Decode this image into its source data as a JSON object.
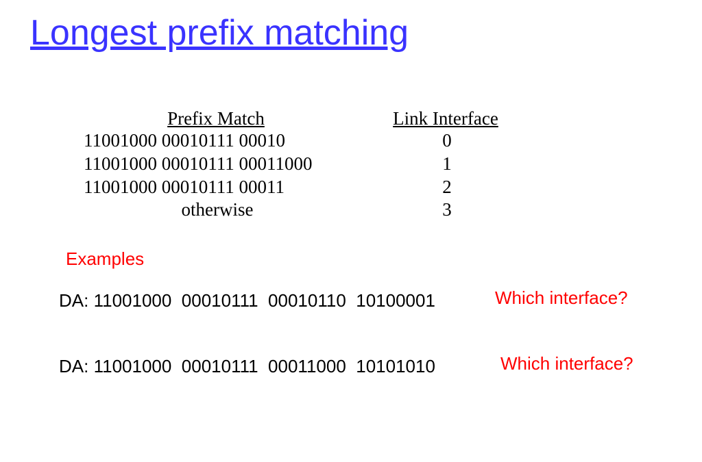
{
  "title": "Longest prefix matching",
  "table": {
    "headers": {
      "prefix": "Prefix Match",
      "link": "Link Interface"
    },
    "rows": [
      {
        "prefix": "11001000 00010111 00010",
        "link": "0"
      },
      {
        "prefix": "11001000 00010111 00011000",
        "link": "1"
      },
      {
        "prefix": "11001000 00010111 00011",
        "link": "2"
      },
      {
        "prefix": "otherwise",
        "link": "3",
        "otherwise": true
      }
    ]
  },
  "examples_label": "Examples",
  "examples": [
    {
      "prefix_label": "DA: ",
      "unhighlighted": "11001000  00010111  0001",
      "highlighted": "0110  10100001",
      "question": "Which interface?"
    },
    {
      "prefix_label": "DA: ",
      "unhighlighted": "11001000  00010111  0001",
      "highlighted": "1000  10101010",
      "question": "Which interface?"
    }
  ]
}
